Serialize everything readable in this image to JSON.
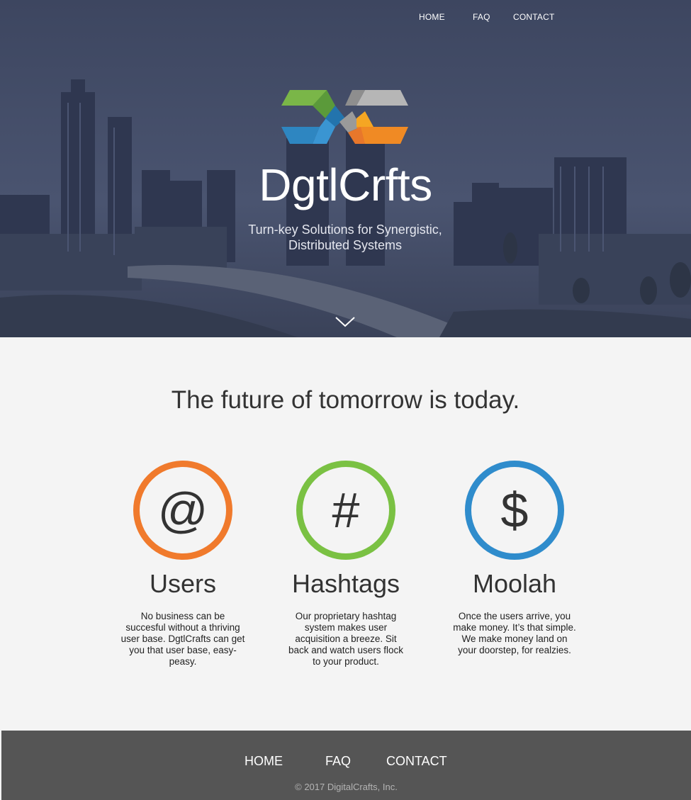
{
  "nav": {
    "home": "HOME",
    "faq": "FAQ",
    "contact": "CONTACT"
  },
  "hero": {
    "brand": "DgtlCrfts",
    "tagline": "Turn-key Solutions for Synergistic, Distributed Systems",
    "scroll_icon": "chevron-down-icon",
    "logo_colors": [
      "#7ab648",
      "#2e86c1",
      "#a9a9a9",
      "#f08a24"
    ]
  },
  "main": {
    "headline": "The future of tomorrow is today.",
    "features": [
      {
        "symbol": "@",
        "title": "Users",
        "description": "No business can be succesful without a thriving user base. DgtlCrafts can get you that user base, easy-peasy.",
        "ring_color": "#f07a2c"
      },
      {
        "symbol": "#",
        "title": "Hashtags",
        "description": "Our proprietary hashtag system makes user acquisition a breeze. Sit back and watch users flock to your product.",
        "ring_color": "#7ac143"
      },
      {
        "symbol": "$",
        "title": "Moolah",
        "description": "Once the users arrive, you make money. It’s that simple. We make money land on your doorstep, for realzies.",
        "ring_color": "#2f8ccc"
      }
    ]
  },
  "footer": {
    "home": "HOME",
    "faq": "FAQ",
    "contact": "CONTACT",
    "copyright": "© 2017 DigitalCrafts, Inc."
  }
}
